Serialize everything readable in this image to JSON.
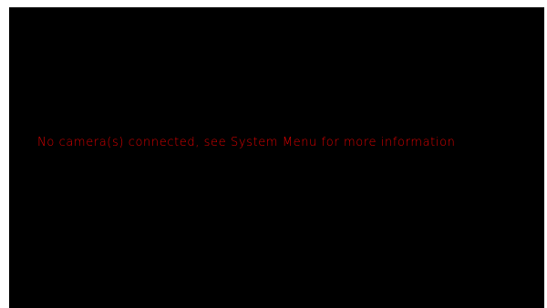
{
  "display": {
    "message": "No camera(s) connected, see System Menu for more information"
  },
  "colors": {
    "background": "#000000",
    "message_text": "#e00000",
    "border": "#ffffff"
  }
}
